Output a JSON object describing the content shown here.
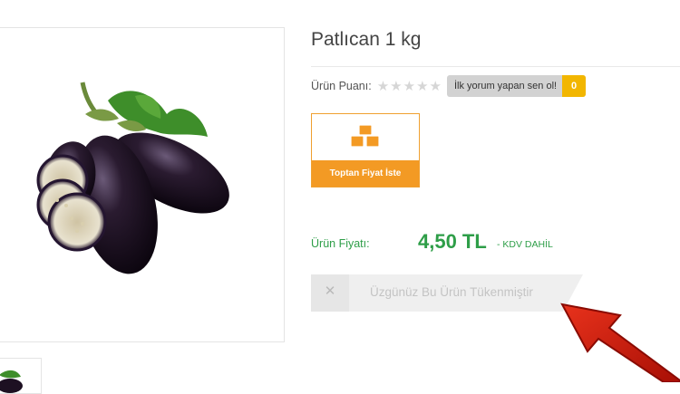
{
  "product": {
    "title": "Patlıcan 1 kg",
    "rating_label": "Ürün Puanı:",
    "stars_filled": 0,
    "stars_total": 5,
    "review_prompt": "İlk yorum yapan sen ol!",
    "review_count": "0",
    "wholesale_button": "Toptan Fiyat İste",
    "price_label": "Ürün Fiyatı:",
    "price": "4,50 TL",
    "tax_note": "- KDV DAHİL",
    "soldout_label": "Üzgünüz Bu Ürün Tükenmiştir"
  },
  "icons": {
    "star": "star-icon",
    "boxes": "boxes-icon",
    "close": "close-icon",
    "arrow": "red-arrow"
  },
  "colors": {
    "price_green": "#2e9e48",
    "wholesale_orange": "#f39a24",
    "review_yellow": "#f2b600",
    "arrow_red": "#cc1a0a"
  }
}
